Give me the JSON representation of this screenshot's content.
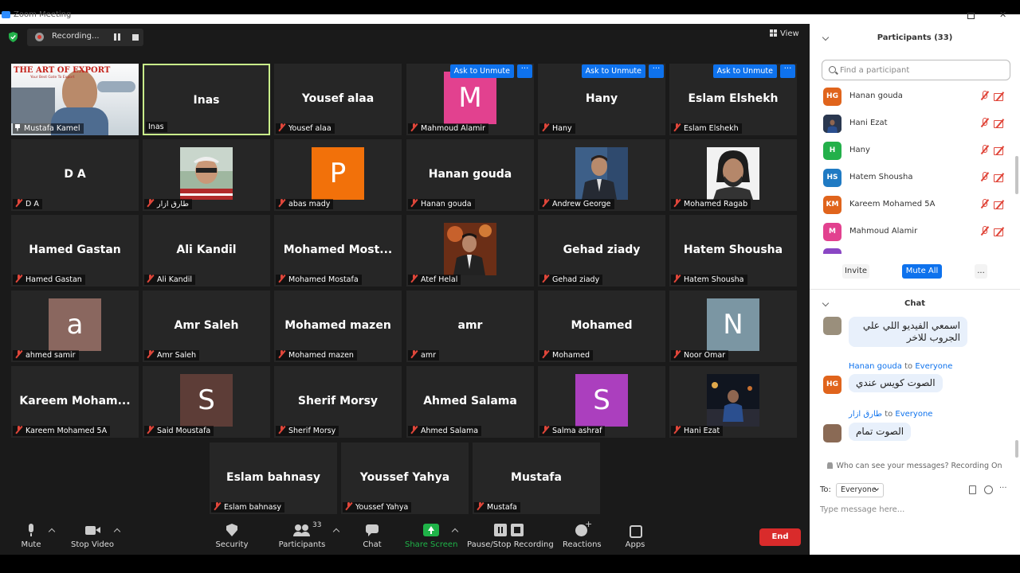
{
  "window": {
    "title": "Zoom Meeting"
  },
  "recording": {
    "label": "Recording..."
  },
  "view": {
    "label": "View"
  },
  "tiles": [
    {
      "name": "Mustafa Kamel",
      "display": "",
      "kind": "photo-kamel",
      "pinned": true,
      "brand": "THE ART OF EXPORT",
      "brand_sub": "Your Best Gate To Export"
    },
    {
      "name": "Inas",
      "display": "Inas",
      "kind": "name",
      "active": true,
      "muted": false
    },
    {
      "name": "Yousef alaa",
      "display": "Yousef alaa",
      "kind": "name"
    },
    {
      "name": "Mahmoud Alamir",
      "display": "",
      "kind": "avatar",
      "letter": "M",
      "color": "#e2418f",
      "unmute": true
    },
    {
      "name": "Hany",
      "display": "Hany",
      "kind": "name",
      "unmute": true
    },
    {
      "name": "Eslam Elshekh",
      "display": "Eslam Elshekh",
      "kind": "name",
      "unmute": true
    },
    {
      "name": "D A",
      "display": "D A",
      "kind": "name"
    },
    {
      "name": "طارق ازار",
      "display": "",
      "kind": "photo",
      "photo": "p-tarek"
    },
    {
      "name": "abas mady",
      "display": "",
      "kind": "avatar",
      "letter": "P",
      "color": "#f2710a"
    },
    {
      "name": "Hanan gouda",
      "display": "Hanan gouda",
      "kind": "name"
    },
    {
      "name": "Andrew George",
      "display": "",
      "kind": "photo",
      "photo": "p-andrew"
    },
    {
      "name": "Mohamed Ragab",
      "display": "",
      "kind": "photo",
      "photo": "p-ragab"
    },
    {
      "name": "Hamed Gastan",
      "display": "Hamed Gastan",
      "kind": "name"
    },
    {
      "name": "Ali Kandil",
      "display": "Ali Kandil",
      "kind": "name"
    },
    {
      "name": "Mohamed Mostafa",
      "display": "Mohamed  Most...",
      "kind": "name"
    },
    {
      "name": "Atef Helal",
      "display": "",
      "kind": "photo",
      "photo": "p-atef"
    },
    {
      "name": "Gehad ziady",
      "display": "Gehad ziady",
      "kind": "name"
    },
    {
      "name": "Hatem Shousha",
      "display": "Hatem Shousha",
      "kind": "name"
    },
    {
      "name": "ahmed samir",
      "display": "",
      "kind": "avatar",
      "letter": "a",
      "color": "#8a675f"
    },
    {
      "name": "Amr Saleh",
      "display": "Amr Saleh",
      "kind": "name"
    },
    {
      "name": "Mohamed mazen",
      "display": "Mohamed mazen",
      "kind": "name"
    },
    {
      "name": "amr",
      "display": "amr",
      "kind": "name"
    },
    {
      "name": "Mohamed",
      "display": "Mohamed",
      "kind": "name"
    },
    {
      "name": "Noor Omar",
      "display": "",
      "kind": "avatar",
      "letter": "N",
      "color": "#7b96a3"
    },
    {
      "name": "Kareem Mohamed 5A",
      "display": "Kareem  Moham...",
      "kind": "name"
    },
    {
      "name": "Said Moustafa",
      "display": "",
      "kind": "avatar",
      "letter": "S",
      "color": "#5d3d37"
    },
    {
      "name": "Sherif Morsy",
      "display": "Sherif Morsy",
      "kind": "name"
    },
    {
      "name": "Ahmed Salama",
      "display": "Ahmed Salama",
      "kind": "name"
    },
    {
      "name": "Salma ashraf",
      "display": "",
      "kind": "avatar",
      "letter": "S",
      "color": "#ab3fbe"
    },
    {
      "name": "Hani Ezat",
      "display": "",
      "kind": "photo",
      "photo": "p-hani"
    },
    {
      "name": "Eslam bahnasy",
      "display": "Eslam bahnasy",
      "kind": "name"
    },
    {
      "name": "Youssef Yahya",
      "display": "Youssef Yahya",
      "kind": "name"
    },
    {
      "name": "Mustafa",
      "display": "Mustafa",
      "kind": "name"
    }
  ],
  "unmute_label": "Ask to Unmute",
  "more_label": "···",
  "toolbar": {
    "mute": "Mute",
    "stop_video": "Stop Video",
    "security": "Security",
    "participants": "Participants",
    "participants_count": "33",
    "chat": "Chat",
    "share_screen": "Share Screen",
    "pause_stop": "Pause/Stop Recording",
    "reactions": "Reactions",
    "apps": "Apps",
    "end": "End"
  },
  "participants_panel": {
    "title": "Participants (33)",
    "search_placeholder": "Find a participant",
    "list": [
      {
        "initials": "HG",
        "name": "Hanan gouda",
        "color": "#e0641c"
      },
      {
        "initials": "",
        "name": "Hani Ezat",
        "color": "#2a3850",
        "photo": true
      },
      {
        "initials": "H",
        "name": "Hany",
        "color": "#23b04a"
      },
      {
        "initials": "HS",
        "name": "Hatem Shousha",
        "color": "#1f7ac3"
      },
      {
        "initials": "KM",
        "name": "Kareem Mohamed 5A",
        "color": "#e0641c"
      },
      {
        "initials": "M",
        "name": "Mahmoud Alamir",
        "color": "#e2418f"
      }
    ],
    "invite": "Invite",
    "mute_all": "Mute All",
    "more": "..."
  },
  "chat_panel": {
    "title": "Chat",
    "messages": [
      {
        "sender": "",
        "to": "",
        "text": "اسمعي الفيديو اللي علي الجروب للاخر",
        "avatar_initials": "",
        "avatar_color": "#9a8f7c"
      },
      {
        "sender": "Hanan gouda",
        "to_word": "to",
        "to": "Everyone",
        "text": "الصوت كويس عندي",
        "avatar_initials": "HG",
        "avatar_color": "#e0641c"
      },
      {
        "sender": "طارق ازار",
        "to_word": "to",
        "to": "Everyone",
        "text": "الصوت تمام",
        "avatar_initials": "",
        "avatar_color": "#8a6a55"
      }
    ],
    "notice": "Who can see your messages? Recording On",
    "to_label": "To:",
    "to_value": "Everyone",
    "input_placeholder": "Type message here..."
  }
}
